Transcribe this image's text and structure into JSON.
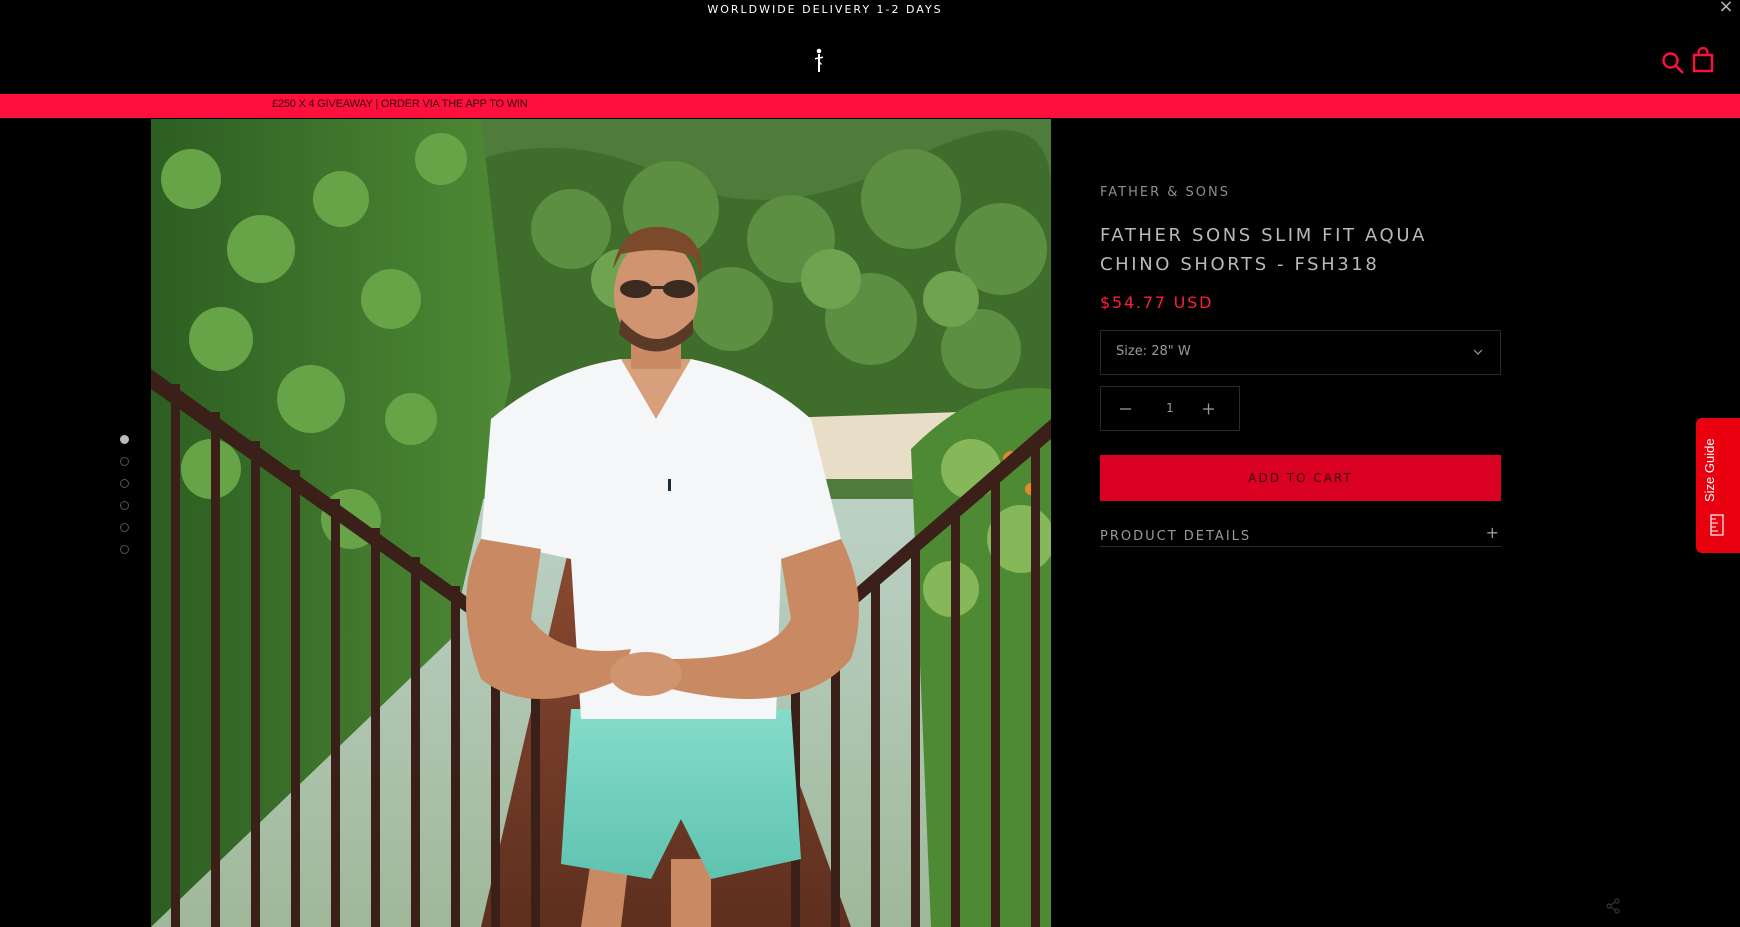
{
  "announcement": {
    "text": "WORLDWIDE DELIVERY 1-2 DAYS",
    "close_label": "×"
  },
  "header": {
    "logo_icon": "father-and-sons-logo-icon",
    "search_icon": "search-icon",
    "cart_icon": "shopping-bag-icon"
  },
  "promo": {
    "text": "£250 X 4 GIVEAWAY | ORDER VIA THE APP TO WIN"
  },
  "gallery": {
    "image_count": 6,
    "active_index": 0
  },
  "product": {
    "vendor": "FATHER & SONS",
    "title": "FATHER SONS SLIM FIT AQUA CHINO SHORTS - FSH318",
    "price": "$54.77 USD",
    "size_label": "Size: 28\" W",
    "quantity": "1",
    "add_to_cart": "ADD TO CART",
    "details_label": "PRODUCT DETAILS",
    "details_toggle": "+"
  },
  "size_guide": {
    "label": "Size Guide",
    "icon": "ruler-icon"
  },
  "share": {
    "icon": "share-icon"
  },
  "colors": {
    "accent": "#ff0f3c",
    "cta": "#d90022",
    "price": "#ff1e3c",
    "background": "#000000"
  }
}
